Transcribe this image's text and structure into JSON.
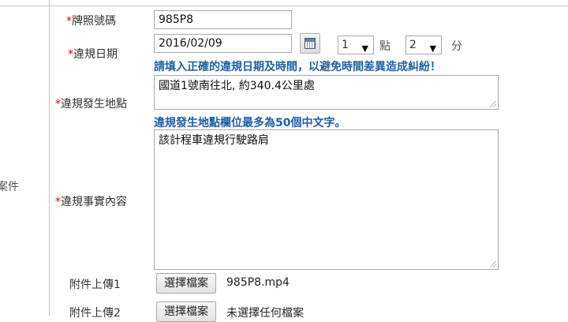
{
  "category": {
    "label": "案件"
  },
  "form": {
    "plate": {
      "label": "牌照號碼",
      "required_mark": "*",
      "value": "985P8"
    },
    "date": {
      "label": "違規日期",
      "required_mark": "*",
      "value": "2016/02/09",
      "hour_value": "1",
      "hour_unit": "點",
      "minute_value": "2",
      "minute_unit": "分",
      "hint": "請填入正確的違規日期及時間，以避免時間差異造成糾紛！"
    },
    "location": {
      "label": "違規發生地點",
      "required_mark": "*",
      "value": "國道1號南往北, 約340.4公里處",
      "hint": "違規發生地點欄位最多為50個中文字。"
    },
    "facts": {
      "label": "違規事實內容",
      "required_mark": "*",
      "value": "該計程車違規行駛路肩"
    },
    "attachment1": {
      "label": "附件上傳1",
      "button": "選擇檔案",
      "file": "985P8.mp4"
    },
    "attachment2": {
      "label": "附件上傳2",
      "button": "選擇檔案",
      "file": "未選擇任何檔案"
    }
  },
  "icons": {
    "calendar": "calendar-icon",
    "dropdown": "dropdown-arrow-icon"
  },
  "colors": {
    "required": "#e00000",
    "hint": "#1f5fa8",
    "border": "#b7c6d6"
  }
}
